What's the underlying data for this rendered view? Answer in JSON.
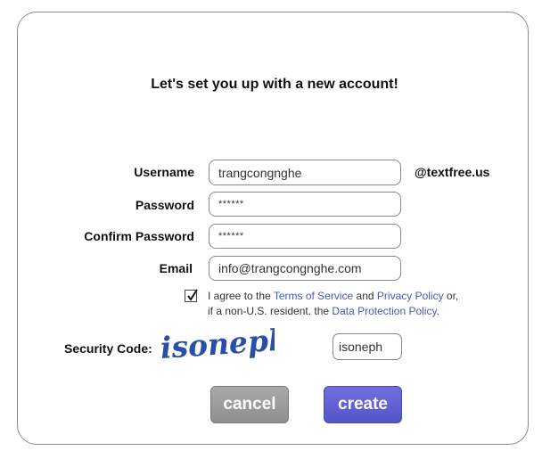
{
  "form": {
    "title": "Let's set you up with a new account!",
    "username_label": "Username",
    "username_value": "trangcongnghe",
    "username_suffix": "@textfree.us",
    "password_label": "Password",
    "password_value": "******",
    "confirm_label": "Confirm Password",
    "confirm_value": "******",
    "email_label": "Email",
    "email_value": "info@trangcongnghe.com"
  },
  "agreement": {
    "checked": true,
    "text1": "I agree to the ",
    "terms_link": "Terms of Service",
    "and": " and ",
    "privacy_link": "Privacy Policy",
    "or": " or,",
    "text2": "if a non-U.S. resident. the ",
    "data_link": "Data Protection Policy",
    "end": "."
  },
  "captcha": {
    "label": "Security Code:",
    "image_text": "isoneph",
    "input_value": "isoneph"
  },
  "buttons": {
    "cancel": "cancel",
    "create": "create"
  },
  "colors": {
    "link": "#4a59b3",
    "create_button": "#5a5ad0",
    "cancel_button": "#9a9a9a",
    "captcha_text": "#2a4fa8"
  }
}
